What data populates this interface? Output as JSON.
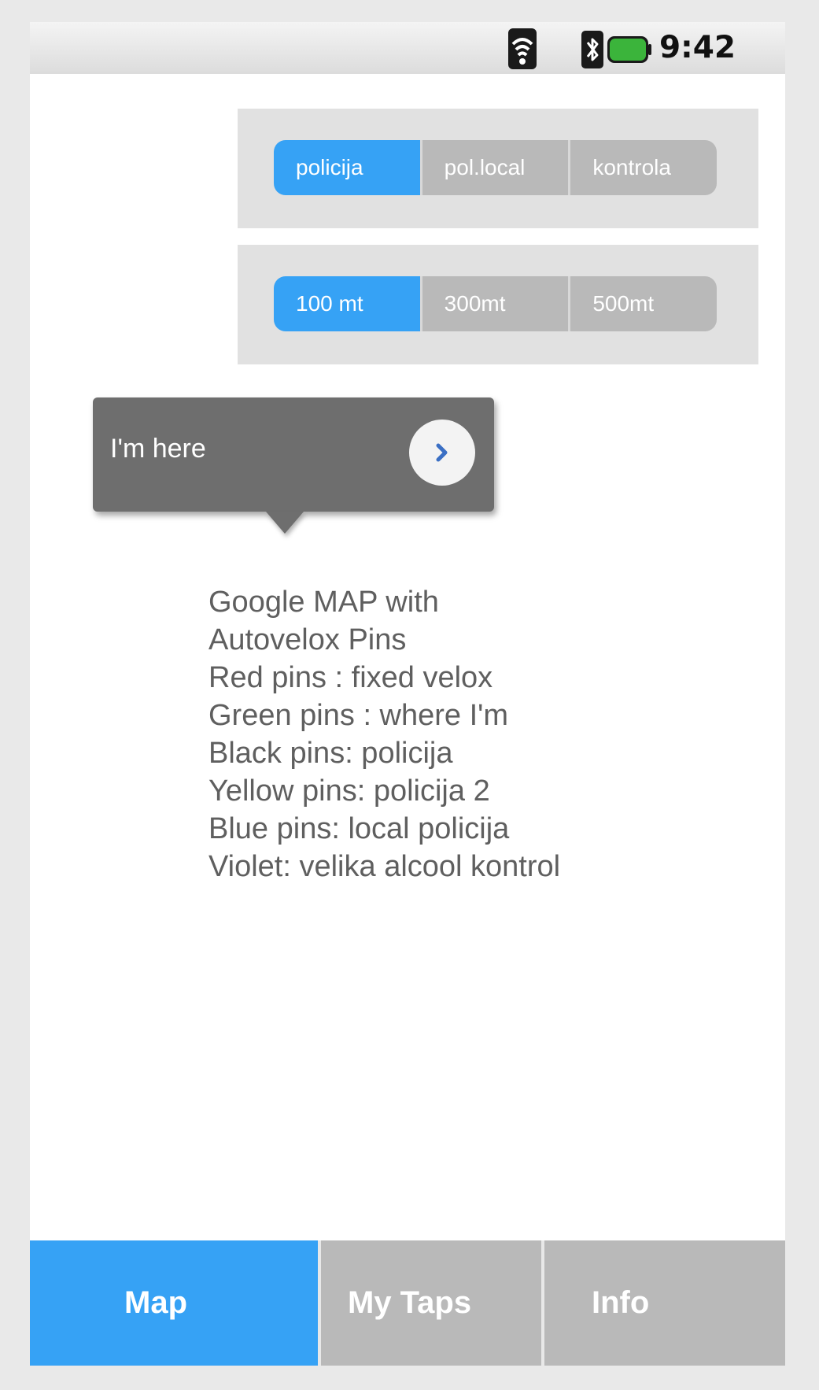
{
  "status_bar": {
    "time": "9:42",
    "icons": [
      "wifi-signal-icon",
      "bluetooth-icon",
      "battery-icon"
    ],
    "battery_color": "#3bb43b"
  },
  "type_filter": {
    "options": [
      "policija",
      "pol.local",
      "kontrola"
    ],
    "selected": "policija"
  },
  "range_filter": {
    "options": [
      "100 mt",
      "300mt",
      "500mt"
    ],
    "selected": "100 mt"
  },
  "callout": {
    "label": "I'm here",
    "button_icon": "chevron-right-icon"
  },
  "description": {
    "lines": [
      "Google MAP with",
      "Autovelox Pins",
      "Red pins : fixed velox",
      "Green pins : where I'm",
      "Black pins:  policija",
      "Yellow pins: policija 2",
      "Blue pins: local policija",
      "Violet: velika alcool kontrol"
    ]
  },
  "tabs": [
    {
      "label": "Map",
      "active": true
    },
    {
      "label": "My Taps",
      "active": false
    },
    {
      "label": "Info",
      "active": false
    }
  ],
  "colors": {
    "accent": "#36a2f5",
    "inactive_segment": "#b9b9b9",
    "panel_bg": "#e1e1e1",
    "callout_bg": "#6e6e6e",
    "text": "#5f5f5f"
  }
}
